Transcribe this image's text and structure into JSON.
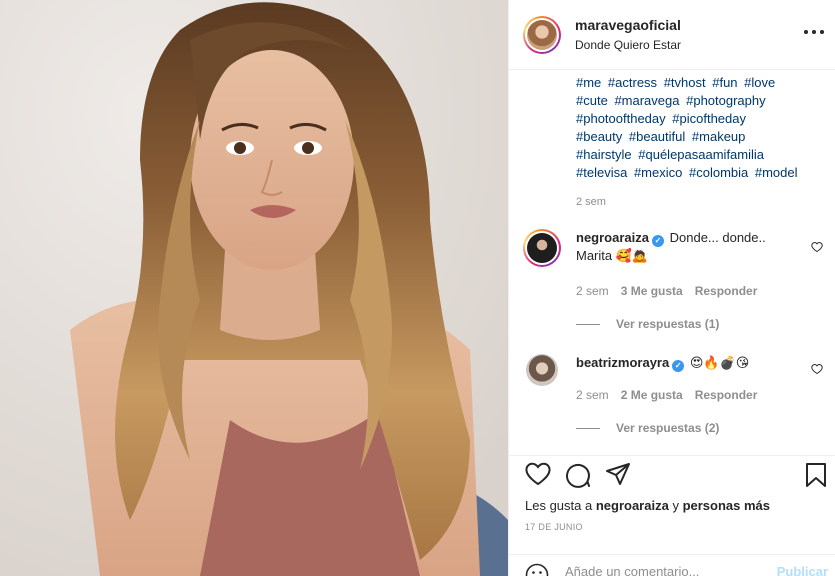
{
  "post": {
    "username": "maravegaoficial",
    "location": "Donde Quiero Estar",
    "caption_cut_line": "·",
    "hashtags": [
      "#me",
      "#actress",
      "#tvhost",
      "#fun",
      "#love",
      "#cute",
      "#maravega",
      "#photography",
      "#photooftheday",
      "#picoftheday",
      "#beauty",
      "#beautiful",
      "#makeup",
      "#hairstyle",
      "#quélepasaamifamilia",
      "#televisa",
      "#mexico",
      "#colombia",
      "#model"
    ],
    "caption_time": "2 sem"
  },
  "comments": [
    {
      "username": "negroaraiza",
      "verified": true,
      "text": "Donde... donde..",
      "text2": "Marita",
      "emojis2": "🥰🙇",
      "time": "2 sem",
      "likes": "3 Me gusta",
      "reply": "Responder",
      "view_replies": "Ver respuestas (1)"
    },
    {
      "username": "beatrizmorayra",
      "verified": true,
      "emojis": "😍🔥💣😘",
      "time": "2 sem",
      "likes": "2 Me gusta",
      "reply": "Responder",
      "view_replies": "Ver respuestas (2)"
    }
  ],
  "actions": {
    "likes_prefix": "Les gusta a",
    "likes_user": "negroaraiza",
    "likes_and": "y",
    "likes_others": "personas más",
    "date": "17 DE JUNIO"
  },
  "add_comment": {
    "placeholder": "Añade un comentario...",
    "post_label": "Publicar"
  },
  "icons": {
    "more": "more-options-icon",
    "like": "heart-icon",
    "comment": "comment-icon",
    "share": "share-icon",
    "save": "bookmark-icon",
    "emoji": "smile-icon"
  },
  "colors": {
    "link": "#00376b",
    "verified": "#3897f0",
    "muted": "#8e8e8e",
    "publish_disabled": "#b2dffc"
  }
}
